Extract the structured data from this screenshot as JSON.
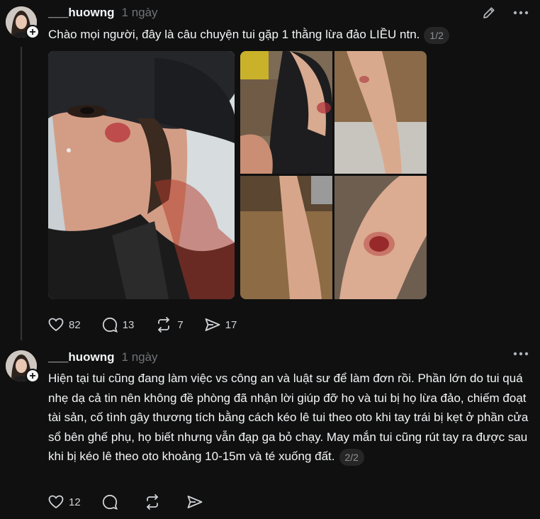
{
  "posts": [
    {
      "username": "___huowng",
      "time": "1 ngày",
      "text": "Chào mọi người, đây là câu chuyện tui gặp 1 thằng lừa đảo LIỀU ntn.",
      "pager": "1/2",
      "stats": {
        "likes": "82",
        "comments": "13",
        "reposts": "7",
        "shares": "17"
      },
      "icons": [
        "edit-icon",
        "more-icon",
        "heart-icon",
        "comment-icon",
        "repost-icon",
        "share-icon"
      ]
    },
    {
      "username": "___huowng",
      "time": "1 ngày",
      "text": "Hiện tại tui cũng đang làm việc vs công an và luật sư để làm đơn rồi. Phần lớn do tui quá nhẹ dạ cả tin nên không đề phòng đã nhận lời giúp đỡ họ và tui bị họ lừa đảo, chiếm đoạt tài sản, cố tình gây thương tích bằng cách kéo lê tui theo oto khi tay trái bị kẹt ở phần cửa sổ bên ghế phụ, họ biết nhưng vẫn đạp ga bỏ chạy. May mắn tui cũng rút tay ra được sau khi bị kéo lê theo oto khoảng 10-15m và té xuống đất.",
      "pager": "2/2",
      "stats": {
        "likes": "12"
      },
      "icons": [
        "more-icon",
        "heart-icon",
        "comment-icon",
        "repost-icon",
        "share-icon"
      ]
    }
  ],
  "colors": {
    "background": "#101010",
    "text": "#f3f5f7",
    "muted": "#6f7378",
    "thread": "#333638"
  }
}
